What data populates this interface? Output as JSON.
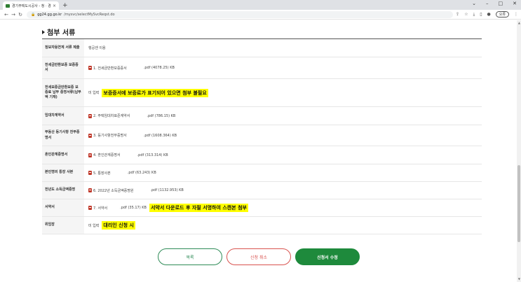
{
  "browser": {
    "tab_title": "경기주택도시공사 - 청 · 경 ·",
    "tab_close": "×",
    "new_tab": "+",
    "window_controls": [
      "⌄",
      "–",
      "□",
      "✕"
    ],
    "url_host": "gg24.gg.go.kr",
    "url_path": "/mysvc/selectMySvcReqst.do",
    "profile_button": "오류"
  },
  "section": {
    "title": "첨부 서류"
  },
  "rows": [
    {
      "label": "정보자동연계 서류 제출",
      "value": "행공센 이용"
    },
    {
      "label": "전세금반환보증 보증증서",
      "file_name": "1. 전세금반환보증증서",
      "file_meta": ".pdf (4078.25) KB"
    },
    {
      "label": "전세보증금반환보증 보증료 납부 증명서류(납부액 기재)",
      "value": "미 입력",
      "note": "보증증서에 보증료가 표기되어 있으면 첨부 불필요"
    },
    {
      "label": "임대차계약서",
      "file_name": "2. 주택임대차표준계약서",
      "file_meta": ".pdf (786.15) KB"
    },
    {
      "label": "부동산 등기사항 전부증명서",
      "file_name": "3. 등기사항전부증명서",
      "file_meta": ".pdf (1608.364) KB"
    },
    {
      "label": "혼인관계증명서",
      "file_name": "4. 혼인관계증명서",
      "file_meta": ".pdf (313.314) KB"
    },
    {
      "label": "본인명의 통장 사본",
      "file_name": "5. 통장사본",
      "file_meta": ".pdf (63.243) KB"
    },
    {
      "label": "전년도 소득금액증명",
      "file_name": "6. 2022년 소득금액증명원",
      "file_meta": ".pdf (1132.953) KB"
    },
    {
      "label": "서약서",
      "file_name": "7. 서약서",
      "file_meta": ".pdf (35.17) KB",
      "note": "서약서 다운로드 후 자필 서명하여 스캔본 첨부"
    },
    {
      "label": "위임장",
      "value": "미 입력",
      "note": "대리인 신청 시"
    }
  ],
  "buttons": {
    "list": "목록",
    "cancel": "신청 취소",
    "edit": "신청서 수정"
  },
  "colors": {
    "primary_green": "#1e8a3c",
    "cancel_red": "#d9534f",
    "highlight": "#ffff00"
  }
}
